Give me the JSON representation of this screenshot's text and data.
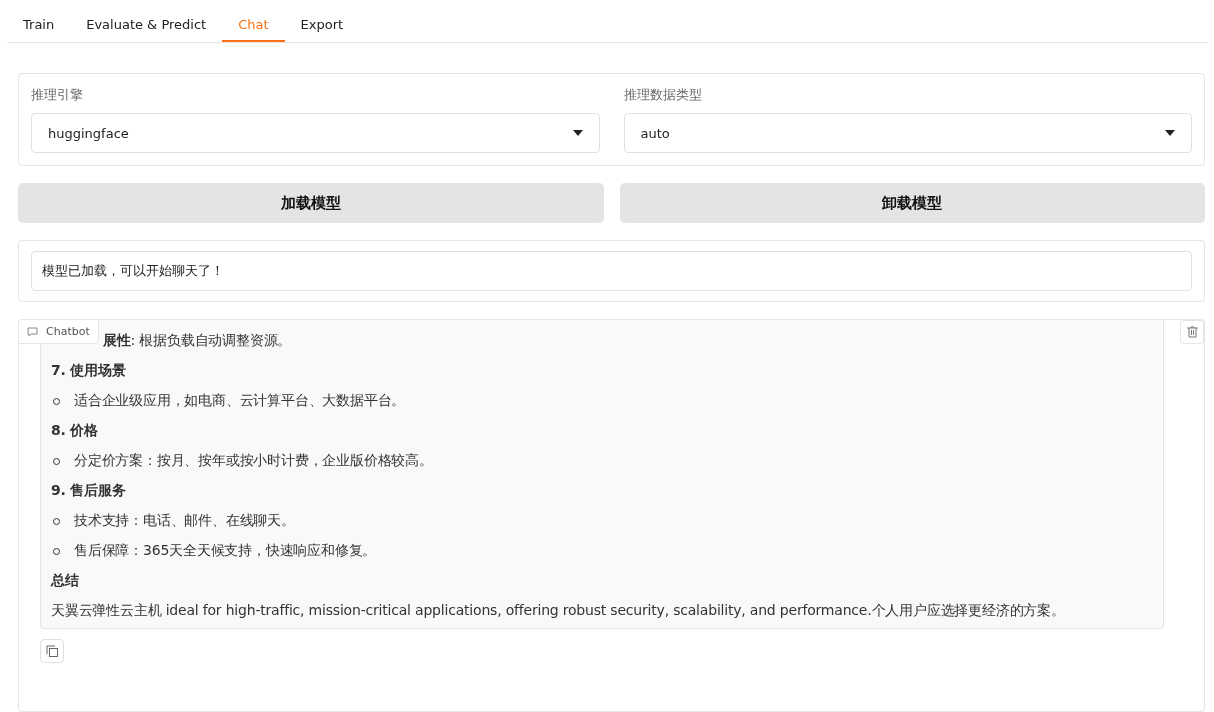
{
  "tabs": [
    {
      "label": "Train",
      "selected": false
    },
    {
      "label": "Evaluate & Predict",
      "selected": false
    },
    {
      "label": "Chat",
      "selected": true
    },
    {
      "label": "Export",
      "selected": false
    }
  ],
  "selects": [
    {
      "label": "推理引擎",
      "value": "huggingface"
    },
    {
      "label": "推理数据类型",
      "value": "auto"
    }
  ],
  "buttons": [
    "加载模型",
    "卸载模型"
  ],
  "status": {
    "value": "模型已加载，可以开始聊天了！"
  },
  "chatbot": {
    "label": "Chatbot",
    "message": [
      {
        "kind": "plain",
        "text": "**展性**: 根据负载自动调整资源。"
      },
      {
        "kind": "heading",
        "text": "7. 使用场景"
      },
      {
        "kind": "bullet",
        "text": "适合企业级应用，如电商、云计算平台、大数据平台。"
      },
      {
        "kind": "heading",
        "text": "8. 价格"
      },
      {
        "kind": "bullet",
        "text": "分定价方案：按月、按年或按小时计费，企业版价格较高。"
      },
      {
        "kind": "heading",
        "text": "9. 售后服务"
      },
      {
        "kind": "bullet",
        "text": "技术支持：电话、邮件、在线聊天。"
      },
      {
        "kind": "bullet",
        "text": "售后保障：365天全天候支持，快速响应和修复。"
      },
      {
        "kind": "heading",
        "text": "总结"
      },
      {
        "kind": "paragraph",
        "text": "天翼云弹性云主机 ideal for high-traffic, mission-critical applications, offering robust security, scalability, and performance.个人用户应选择更经济的方案。"
      }
    ]
  }
}
